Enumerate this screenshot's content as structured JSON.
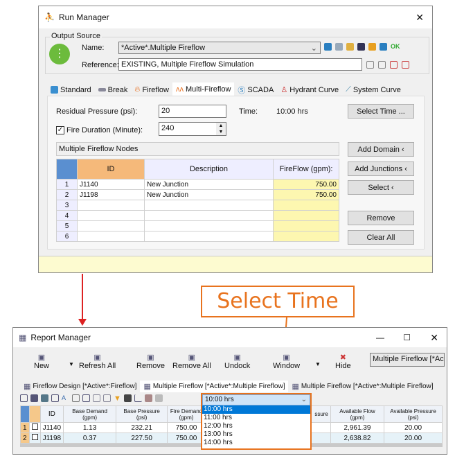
{
  "run_manager": {
    "title": "Run Manager",
    "close": "✕",
    "output_source": "Output Source",
    "name_label": "Name:",
    "name_value": "*Active*.Multiple Fireflow",
    "reference_label": "Reference:",
    "reference_value": "EXISTING, Multiple Fireflow Simulation",
    "ok": "OK",
    "tabs": [
      "Standard",
      "Break",
      "Fireflow",
      "Multi-Fireflow",
      "SCADA",
      "Hydrant Curve",
      "System Curve"
    ],
    "residual_label": "Residual Pressure (psi):",
    "residual_value": "20",
    "time_label": "Time:",
    "time_value": "10:00 hrs",
    "duration_label": "Fire Duration (Minute):",
    "duration_value": "240",
    "duration_checked": true,
    "nodes_label": "Multiple Fireflow Nodes",
    "columns": [
      "ID",
      "Description",
      "FireFlow (gpm):"
    ],
    "rows": [
      {
        "n": "1",
        "id": "J1140",
        "desc": "New Junction",
        "flow": "750.00"
      },
      {
        "n": "2",
        "id": "J1198",
        "desc": "New Junction",
        "flow": "750.00"
      },
      {
        "n": "3",
        "id": "",
        "desc": "",
        "flow": ""
      },
      {
        "n": "4",
        "id": "",
        "desc": "",
        "flow": ""
      },
      {
        "n": "5",
        "id": "",
        "desc": "",
        "flow": ""
      },
      {
        "n": "6",
        "id": "",
        "desc": "",
        "flow": ""
      }
    ],
    "buttons": {
      "select_time": "Select Time ...",
      "add_domain": "Add Domain ‹",
      "add_junctions": "Add Junctions ‹",
      "select": "Select ‹",
      "remove": "Remove",
      "clear_all": "Clear All"
    }
  },
  "callout": {
    "text": "Select Time",
    "color": "#e8731e"
  },
  "report_manager": {
    "title": "Report Manager",
    "toolbar": [
      "New",
      "Refresh All",
      "Remove",
      "Remove All",
      "Undock",
      "Window",
      "Hide"
    ],
    "selector": "Multiple Fireflow [*Ac",
    "tabs": [
      "Fireflow Design [*Active*:Fireflow]",
      "Multiple Fireflow [*Active*:Multiple Fireflow]",
      "Multiple Fireflow [*Active*:Multiple Fireflow]"
    ],
    "time_select": "10:00 hrs",
    "time_options": [
      "10:00 hrs",
      "11:00 hrs",
      "12:00 hrs",
      "13:00 hrs",
      "14:00 hrs"
    ],
    "columns": [
      "ID",
      "Base Demand (gpm)",
      "Base Pressure (psi)",
      "Fire Demand (gpm)",
      "ssure",
      "Available Flow (gpm)",
      "Available Pressure (psi)"
    ],
    "rows": [
      {
        "n": "1",
        "id": "J1140",
        "bd": "1.13",
        "bp": "232.21",
        "fd": "750.00",
        "af": "2,961.39",
        "ap": "20.00"
      },
      {
        "n": "2",
        "id": "J1198",
        "bd": "0.37",
        "bp": "227.50",
        "fd": "750.00",
        "af": "2,638.82",
        "ap": "20.00"
      }
    ]
  }
}
